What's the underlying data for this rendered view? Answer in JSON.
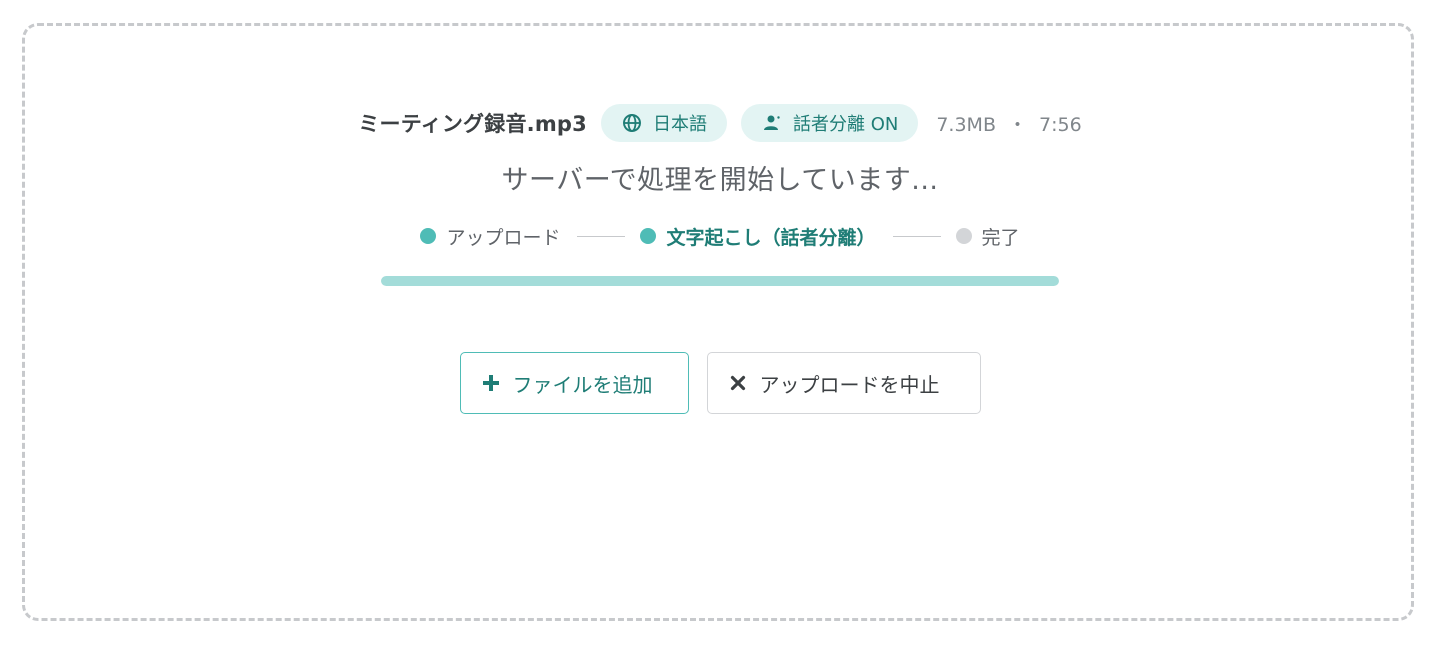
{
  "file": {
    "name": "ミーティング録音.mp3",
    "language_chip": {
      "label": "日本語",
      "icon": "globe-icon"
    },
    "diarization_chip": {
      "label": "話者分離 ON",
      "icon": "person-icon"
    },
    "size": "7.3MB",
    "separator": "・",
    "duration": "7:56"
  },
  "status_message": "サーバーで処理を開始しています...",
  "steps": [
    {
      "label": "アップロード",
      "state": "done"
    },
    {
      "label": "文字起こし（話者分離）",
      "state": "active"
    },
    {
      "label": "完了",
      "state": "pending"
    }
  ],
  "progress": {
    "fraction": 1.0
  },
  "actions": {
    "add_file": {
      "label": "ファイルを追加",
      "icon": "plus-icon"
    },
    "cancel_upload": {
      "label": "アップロードを中止",
      "icon": "close-icon"
    }
  },
  "colors": {
    "accent": "#1f7d76",
    "accent_light": "#4fbcb6",
    "chip_bg": "#e3f4f3",
    "progress_fill": "#a3dcd9",
    "pending": "#d3d5d8"
  }
}
